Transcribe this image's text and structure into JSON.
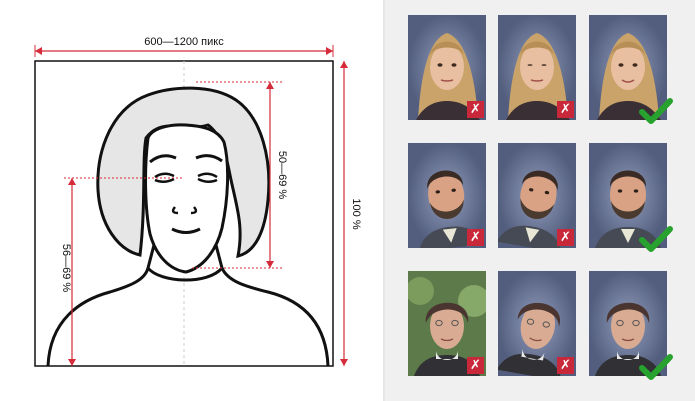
{
  "colors": {
    "dimension_red": "#d62b3a",
    "reject_badge": "#c8283a",
    "accept_check": "#27a22e",
    "photo_background": "#6f7ea8"
  },
  "left_diagram": {
    "width_label": "600—1200 пикс",
    "face_height_label": "50—69 %",
    "eye_height_label": "56—69 %",
    "full_height_label": "100 %"
  },
  "photo_grid": {
    "rows": [
      {
        "subject": "woman-blonde",
        "cells": [
          {
            "mark": "reject",
            "mark_icon": "cross-icon",
            "mark_text": "✗"
          },
          {
            "mark": "reject",
            "mark_icon": "cross-icon",
            "mark_text": "✗"
          },
          {
            "mark": "accept",
            "mark_icon": "check-icon"
          }
        ]
      },
      {
        "subject": "man-beard",
        "cells": [
          {
            "mark": "reject",
            "mark_icon": "cross-icon",
            "mark_text": "✗"
          },
          {
            "mark": "reject",
            "mark_icon": "cross-icon",
            "mark_text": "✗"
          },
          {
            "mark": "accept",
            "mark_icon": "check-icon"
          }
        ]
      },
      {
        "subject": "elderly-woman",
        "cells": [
          {
            "mark": "reject",
            "mark_icon": "cross-icon",
            "mark_text": "✗"
          },
          {
            "mark": "reject",
            "mark_icon": "cross-icon",
            "mark_text": "✗"
          },
          {
            "mark": "accept",
            "mark_icon": "check-icon"
          }
        ]
      }
    ]
  }
}
